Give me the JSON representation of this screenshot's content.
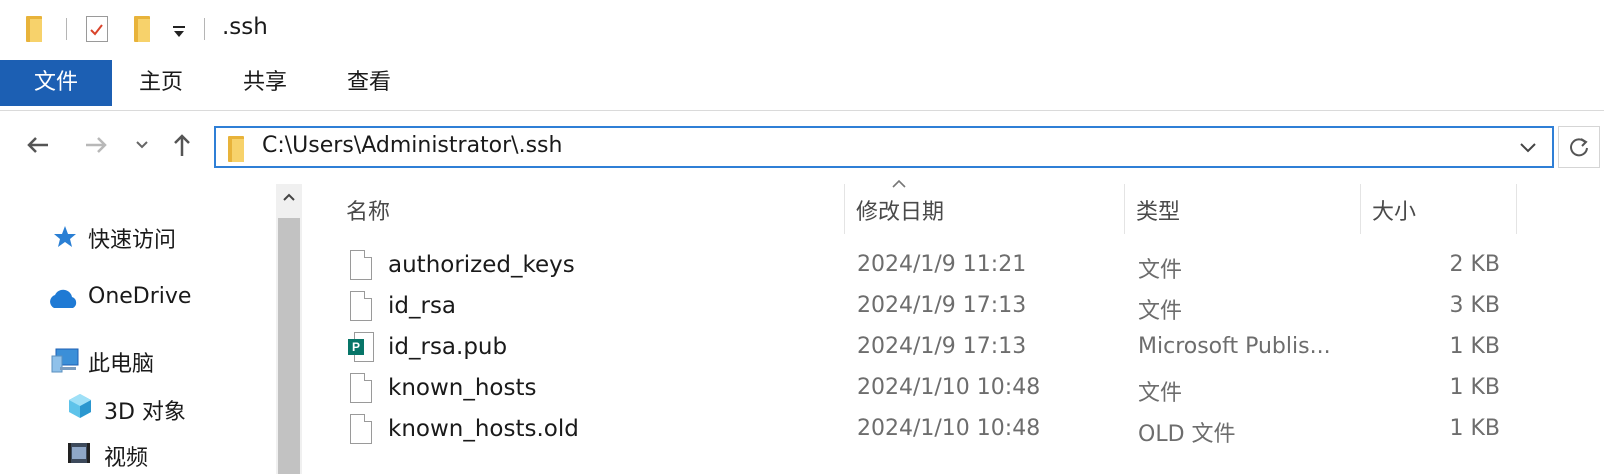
{
  "window": {
    "title": ".ssh"
  },
  "quick_access_toolbar": [
    "folder-icon",
    "properties-icon",
    "new-folder-icon",
    "customize-dropdown-icon"
  ],
  "ribbon": {
    "tabs": [
      {
        "label": "文件",
        "active": true
      },
      {
        "label": "主页"
      },
      {
        "label": "共享"
      },
      {
        "label": "查看"
      }
    ]
  },
  "address_bar": {
    "path": "C:\\Users\\Administrator\\.ssh"
  },
  "nav_pane": {
    "items": [
      {
        "label": "快速访问",
        "icon": "star-icon"
      },
      {
        "label": "OneDrive",
        "icon": "cloud-icon"
      },
      {
        "label": "此电脑",
        "icon": "computer-icon"
      },
      {
        "label": "3D 对象",
        "icon": "cube-icon"
      },
      {
        "label": "视频",
        "icon": "video-icon"
      }
    ]
  },
  "file_list": {
    "columns": [
      "名称",
      "修改日期",
      "类型",
      "大小"
    ],
    "rows": [
      {
        "name": "authorized_keys",
        "date": "2024/1/9 11:21",
        "type": "文件",
        "size": "2 KB",
        "icon": "file-icon"
      },
      {
        "name": "id_rsa",
        "date": "2024/1/9 17:13",
        "type": "文件",
        "size": "3 KB",
        "icon": "file-icon"
      },
      {
        "name": "id_rsa.pub",
        "date": "2024/1/9 17:13",
        "type": "Microsoft Publis...",
        "size": "1 KB",
        "icon": "publisher-icon"
      },
      {
        "name": "known_hosts",
        "date": "2024/1/10 10:48",
        "type": "文件",
        "size": "1 KB",
        "icon": "file-icon"
      },
      {
        "name": "known_hosts.old",
        "date": "2024/1/10 10:48",
        "type": "OLD 文件",
        "size": "1 KB",
        "icon": "file-icon"
      }
    ]
  },
  "colors": {
    "accent": "#1c5fb3",
    "address_border": "#2f7fd6",
    "folder": "#f7d26b",
    "publisher_badge": "#077568"
  }
}
